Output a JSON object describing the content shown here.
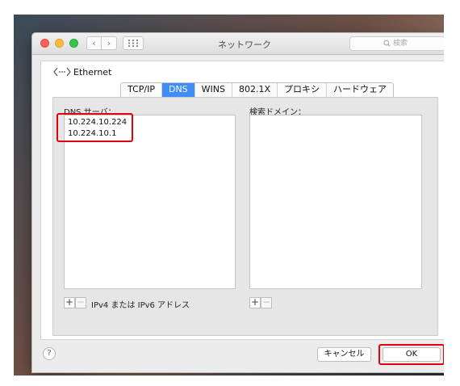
{
  "window": {
    "title": "ネットワーク",
    "search_placeholder": "検索",
    "interface_name": "Ethernet"
  },
  "tabs": [
    {
      "label": "TCP/IP",
      "active": false
    },
    {
      "label": "DNS",
      "active": true
    },
    {
      "label": "WINS",
      "active": false
    },
    {
      "label": "802.1X",
      "active": false
    },
    {
      "label": "プロキシ",
      "active": false
    },
    {
      "label": "ハードウェア",
      "active": false
    }
  ],
  "dns": {
    "servers_label": "DNS サーバ：",
    "servers": [
      "10.224.10.224",
      "10.224.10.1"
    ],
    "search_domains_label": "検索ドメイン：",
    "servers_hint": "IPv4 または IPv6 アドレス"
  },
  "footer": {
    "help": "?",
    "cancel_label": "キャンセル",
    "ok_label": "OK"
  },
  "colors": {
    "accent": "#3e8cf7",
    "highlight": "#e3000f"
  },
  "icons": [
    "traffic-lights",
    "chevron-left-icon",
    "chevron-right-icon",
    "grid-icon",
    "search-icon",
    "network-arrows-icon",
    "help-icon"
  ]
}
